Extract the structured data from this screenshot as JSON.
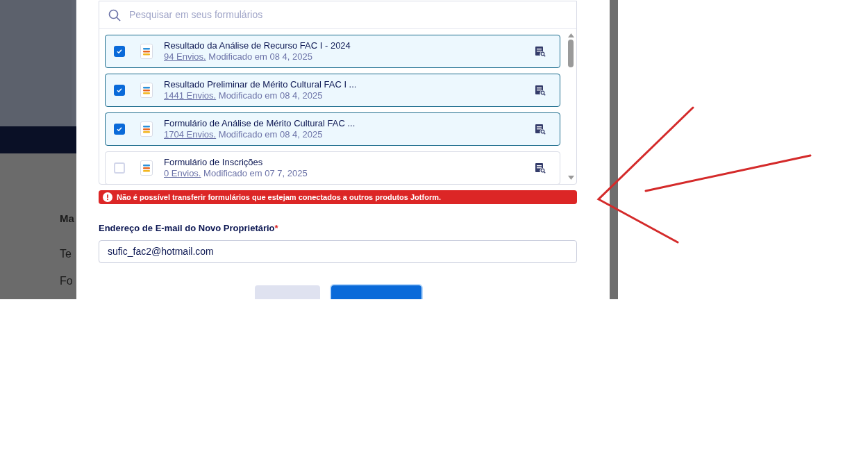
{
  "background": {
    "texts": [
      "Ma",
      "Te",
      "Fo"
    ]
  },
  "search": {
    "placeholder": "Pesquisar em seus formulários"
  },
  "forms": [
    {
      "title": "Resultado da Análise de Recurso FAC I - 2024",
      "submissions": "94 Envios.",
      "modified": "Modificado em 08 4, 2025",
      "selected": true
    },
    {
      "title": "Resultado Preliminar de Mérito Cultural FAC I ...",
      "submissions": "1441 Envios.",
      "modified": "Modificado em 08 4, 2025",
      "selected": true
    },
    {
      "title": "Formulário de Análise de Mérito Cultural FAC ...",
      "submissions": "1704 Envios.",
      "modified": "Modificado em 08 4, 2025",
      "selected": true
    },
    {
      "title": "Formulário de Inscrições",
      "submissions": "0 Envios.",
      "modified": "Modificado em 07 7, 2025",
      "selected": false
    }
  ],
  "error": "Não é possível transferir formulários que estejam conectados a outros produtos Jotform.",
  "email": {
    "label": "Endereço de E-mail do Novo Proprietário",
    "required": "*",
    "value": "sufic_fac2@hotmail.com"
  }
}
